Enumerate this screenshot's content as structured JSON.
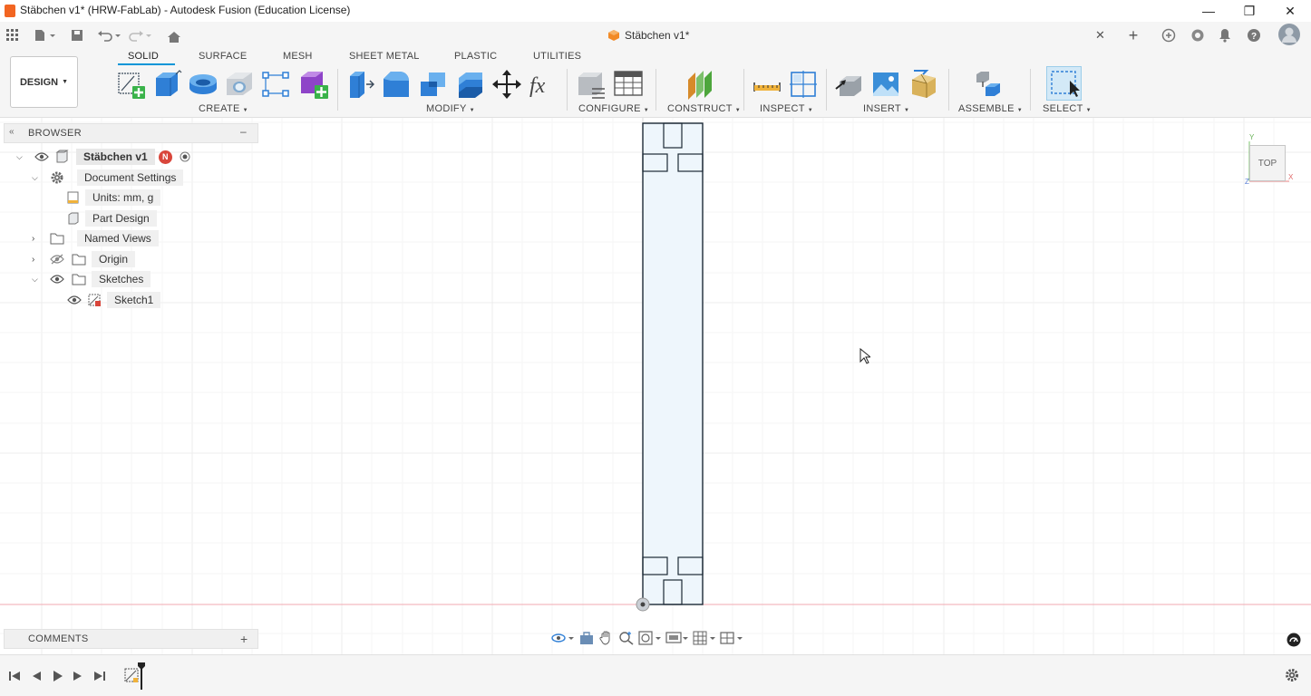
{
  "window": {
    "title": "Stäbchen v1* (HRW-FabLab) - Autodesk Fusion (Education License)"
  },
  "tabbar": {
    "doc_tab_title": "Stäbchen v1*"
  },
  "ribbon": {
    "workspace_button": "DESIGN",
    "tabs": [
      "SOLID",
      "SURFACE",
      "MESH",
      "SHEET METAL",
      "PLASTIC",
      "UTILITIES"
    ],
    "active_tab": "SOLID",
    "groups": {
      "create": "CREATE",
      "modify": "MODIFY",
      "configure": "CONFIGURE",
      "construct": "CONSTRUCT",
      "inspect": "INSPECT",
      "insert": "INSERT",
      "assemble": "ASSEMBLE",
      "select": "SELECT"
    }
  },
  "browser": {
    "title": "BROWSER",
    "root": "Stäbchen v1",
    "root_badge": "N",
    "items": [
      {
        "label": "Document Settings",
        "icon": "gear-icon"
      },
      {
        "label": "Units: mm, g",
        "icon": "units-icon"
      },
      {
        "label": "Part Design",
        "icon": "component-icon"
      },
      {
        "label": "Named Views",
        "icon": "folder-icon"
      },
      {
        "label": "Origin",
        "icon": "folder-icon"
      },
      {
        "label": "Sketches",
        "icon": "folder-icon"
      },
      {
        "label": "Sketch1",
        "icon": "sketch-icon"
      }
    ]
  },
  "comments": {
    "title": "COMMENTS"
  },
  "viewcube": {
    "face": "TOP",
    "axis_y": "Y",
    "axis_x": "X",
    "axis_z": "Z"
  },
  "colors": {
    "accent": "#0696d7",
    "sketch_fill": "#eef6fc",
    "sketch_line": "#1c2a36",
    "grid": "#e4e4e4",
    "x_axis": "#f2a8b0",
    "badge_red": "#d9463b"
  }
}
